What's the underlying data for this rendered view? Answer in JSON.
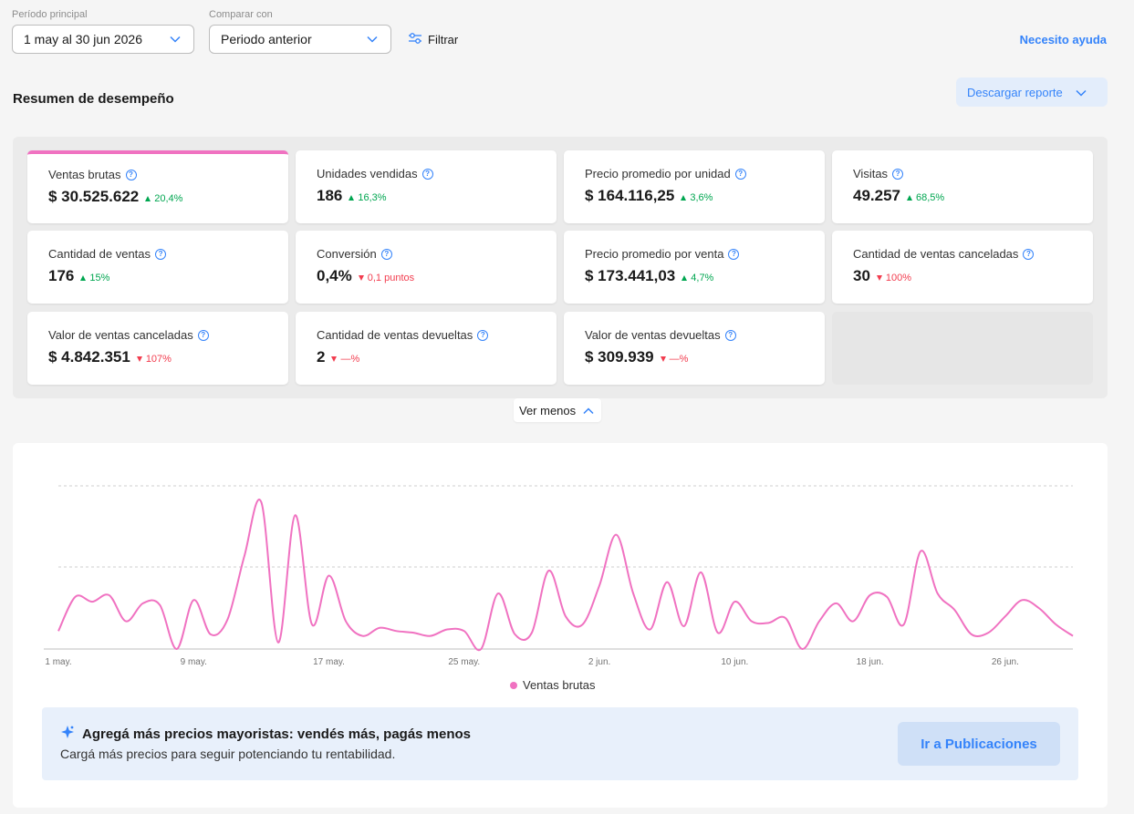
{
  "filters": {
    "period_label": "Período principal",
    "period_value": "1 may al 30 jun 2026",
    "compare_label": "Comparar con",
    "compare_value": "Periodo anterior",
    "filter_label": "Filtrar",
    "help_label": "Necesito ayuda"
  },
  "summary": {
    "title": "Resumen de desempeño",
    "download_label": "Descargar reporte",
    "toggle_label": "Ver menos"
  },
  "colors": {
    "accent": "#3483fa",
    "series": "#f072c1",
    "positive": "#00a650",
    "negative": "#f23d4f"
  },
  "metrics": [
    {
      "label": "Ventas brutas",
      "value": "$ 30.525.622",
      "delta": "20,4%",
      "direction": "up",
      "active": true
    },
    {
      "label": "Unidades vendidas",
      "value": "186",
      "delta": "16,3%",
      "direction": "up"
    },
    {
      "label": "Precio promedio por unidad",
      "value": "$ 164.116,25",
      "delta": "3,6%",
      "direction": "up"
    },
    {
      "label": "Visitas",
      "value": "49.257",
      "delta": "68,5%",
      "direction": "up"
    },
    {
      "label": "Cantidad de ventas",
      "value": "176",
      "delta": "15%",
      "direction": "up"
    },
    {
      "label": "Conversión",
      "value": "0,4%",
      "delta": "0,1 puntos",
      "direction": "down"
    },
    {
      "label": "Precio promedio por venta",
      "value": "$ 173.441,03",
      "delta": "4,7%",
      "direction": "up"
    },
    {
      "label": "Cantidad de ventas canceladas",
      "value": "30",
      "delta": "100%",
      "direction": "down"
    },
    {
      "label": "Valor de ventas canceladas",
      "value": "$ 4.842.351",
      "delta": "107%",
      "direction": "down"
    },
    {
      "label": "Cantidad de ventas devueltas",
      "value": "2",
      "delta": "—%",
      "direction": "down"
    },
    {
      "label": "Valor de ventas devueltas",
      "value": "$ 309.939",
      "delta": "—%",
      "direction": "down"
    }
  ],
  "chart_data": {
    "type": "line",
    "xlabel": "",
    "ylabel": "",
    "grid": true,
    "legend_position": "bottom",
    "tick_labels": [
      "1 may.",
      "9 may.",
      "17 may.",
      "25 may.",
      "2 jun.",
      "10 jun.",
      "18 jun.",
      "26 jun."
    ],
    "tick_days": [
      0,
      8,
      16,
      24,
      32,
      40,
      48,
      56
    ],
    "ylim": [
      0,
      100
    ],
    "series": [
      {
        "name": "Ventas brutas",
        "color": "#f072c1",
        "x": [
          0,
          1,
          2,
          3,
          4,
          5,
          6,
          7,
          8,
          9,
          10,
          11,
          12,
          13,
          14,
          15,
          16,
          17,
          18,
          19,
          20,
          21,
          22,
          23,
          24,
          25,
          26,
          27,
          28,
          29,
          30,
          31,
          32,
          33,
          34,
          35,
          36,
          37,
          38,
          39,
          40,
          41,
          42,
          43,
          44,
          45,
          46,
          47,
          48,
          49,
          50,
          51,
          52,
          53,
          54,
          55,
          56,
          57,
          58,
          59,
          60
        ],
        "values": [
          11,
          32,
          29,
          33,
          17,
          28,
          27,
          0,
          30,
          9,
          18,
          57,
          90,
          4,
          82,
          15,
          45,
          17,
          8,
          13,
          11,
          10,
          8,
          12,
          11,
          0,
          34,
          9,
          10,
          48,
          20,
          15,
          39,
          70,
          34,
          12,
          41,
          14,
          47,
          10,
          29,
          17,
          16,
          19,
          0,
          17,
          28,
          17,
          33,
          32,
          15,
          60,
          34,
          24,
          9,
          10,
          20,
          30,
          25,
          15,
          8
        ]
      }
    ]
  },
  "banner": {
    "title": "Agregá más precios mayoristas: vendés más, pagás menos",
    "text": "Cargá más precios para seguir potenciando tu rentabilidad.",
    "button_label": "Ir a Publicaciones"
  }
}
